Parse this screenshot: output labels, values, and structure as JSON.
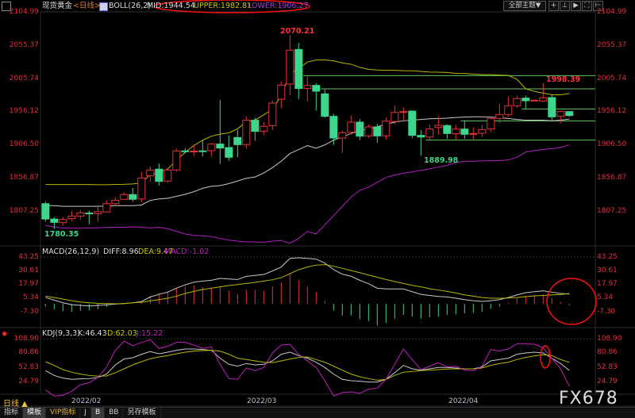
{
  "header": {
    "symbol": "现货黄金",
    "period": "<日线>",
    "indicator": "BOLL(26,2)",
    "mid": "MID:1944.54",
    "upper": "UPPER:1982.81",
    "lower": "LOWER:1906.27",
    "theme_button": "全部主题▼"
  },
  "macd_header": {
    "name": "MACD(26,12,9)",
    "diff": "DIFF:8.96",
    "dea": "DEA:9.47",
    "macd": "MACD:-1.02"
  },
  "kdj_header": {
    "name": "KDJ(9,3,3)",
    "k": "K:46.43",
    "d": "D:62.03",
    "j": "J:15.22"
  },
  "colors": {
    "up": "#e8303c",
    "down": "#3dd68c",
    "mid": "#c8c8c8",
    "upper": "#b8b800",
    "lower": "#b020c0",
    "axis": "#e03040",
    "annotation": "#ff1010"
  },
  "axes": {
    "price_ticks": [
      "2104.99",
      "2055.37",
      "2005.74",
      "1956.12",
      "1906.50",
      "1856.87",
      "1807.25"
    ],
    "macd_ticks": [
      "43.25",
      "30.61",
      "17.97",
      "5.34",
      "-7.30"
    ],
    "kdj_ticks": [
      "108.90",
      "80.86",
      "52.83",
      "24.79"
    ],
    "dates": [
      "2022/02",
      "2022/03",
      "2022/04"
    ]
  },
  "price_labels": {
    "high": "2070.21",
    "low": "1780.35",
    "recent_high": "1998.39",
    "recent_low": "1889.98"
  },
  "footer": {
    "period_label": "日线 ▲",
    "tabs": [
      "指标",
      "模板",
      "VIP指标",
      "J",
      "B",
      "BB",
      "另存模板"
    ],
    "watermark": "FX678"
  },
  "chart_data": {
    "type": "candlestick",
    "ohlc": [
      [
        1818,
        1821,
        1791,
        1795
      ],
      [
        1795,
        1798,
        1780.35,
        1790
      ],
      [
        1789.6,
        1798,
        1785,
        1794.4
      ],
      [
        1795.6,
        1807,
        1792,
        1799.5
      ],
      [
        1799.5,
        1809,
        1794,
        1804.3
      ],
      [
        1804,
        1808,
        1787,
        1803
      ],
      [
        1803,
        1813,
        1791,
        1806
      ],
      [
        1805.5,
        1823,
        1805,
        1818
      ],
      [
        1818,
        1828,
        1814,
        1823
      ],
      [
        1824.5,
        1835,
        1824,
        1831.6
      ],
      [
        1831.6,
        1841.5,
        1821,
        1824.5
      ],
      [
        1825,
        1865.6,
        1820,
        1856.5
      ],
      [
        1859.7,
        1873.5,
        1850.6,
        1868.4
      ],
      [
        1869.6,
        1878,
        1845,
        1851.4
      ],
      [
        1851.8,
        1871.5,
        1849.4,
        1868.4
      ],
      [
        1868.4,
        1900.4,
        1865.6,
        1896.9
      ],
      [
        1896.9,
        1901,
        1893,
        1896.1
      ],
      [
        1896.5,
        1907,
        1889,
        1896.7
      ],
      [
        1897,
        1913,
        1888.6,
        1896.5
      ],
      [
        1897.3,
        1909,
        1888.6,
        1907.2
      ],
      [
        1907.2,
        1973.2,
        1877.5,
        1901.2
      ],
      [
        1902,
        1920.2,
        1882.2,
        1887.4
      ],
      [
        1917,
        1928.9,
        1887.4,
        1906.4
      ],
      [
        1906.4,
        1948.7,
        1900.4,
        1942.8
      ],
      [
        1942.8,
        1946.7,
        1912.3,
        1926.2
      ],
      [
        1926.5,
        1940,
        1920.2,
        1933.7
      ],
      [
        1934.9,
        1972.4,
        1928.1,
        1968.5
      ],
      [
        1974.4,
        2001,
        1960.6,
        1995.4
      ],
      [
        1997,
        2070.21,
        1980.4,
        2047.6
      ],
      [
        2048.8,
        2058.7,
        1974.4,
        1990.3
      ],
      [
        1990.3,
        2008,
        1970.5,
        1995
      ],
      [
        1995,
        1998.2,
        1957.4,
        1986.3
      ],
      [
        1982.3,
        1989,
        1946.7,
        1948.7
      ],
      [
        1948.7,
        1952.7,
        1906,
        1916.3
      ],
      [
        1916.3,
        1927,
        1894,
        1924.2
      ],
      [
        1924.9,
        1949.5,
        1921.8,
        1940
      ],
      [
        1940,
        1944.7,
        1913,
        1919
      ],
      [
        1919.4,
        1936.8,
        1916.3,
        1932.9
      ],
      [
        1932.9,
        1937.6,
        1909,
        1919.4
      ],
      [
        1919.4,
        1946.7,
        1914,
        1941.6
      ],
      [
        1941,
        1964.5,
        1936.8,
        1954.6
      ],
      [
        1954.6,
        1962.2,
        1941.6,
        1955.8
      ],
      [
        1956.6,
        1957.4,
        1916.3,
        1920.2
      ],
      [
        1920.2,
        1928,
        1889.98,
        1917.8
      ],
      [
        1917.8,
        1936.8,
        1913.1,
        1929.7
      ],
      [
        1932,
        1948.7,
        1921,
        1935.2
      ],
      [
        1934.9,
        1936.8,
        1915,
        1923
      ],
      [
        1922.6,
        1936,
        1914,
        1929.7
      ],
      [
        1929.7,
        1942.8,
        1915,
        1921.8
      ],
      [
        1921.8,
        1931.7,
        1914.3,
        1923
      ],
      [
        1923.4,
        1936,
        1917.8,
        1928.9
      ],
      [
        1929.7,
        1946.7,
        1925,
        1945.5
      ],
      [
        1945.5,
        1967.7,
        1938.8,
        1951.5
      ],
      [
        1951.5,
        1978.4,
        1947.9,
        1964.5
      ],
      [
        1964.5,
        1979.6,
        1961.4,
        1975.2
      ],
      [
        1976,
        1979.6,
        1959.8,
        1972
      ],
      [
        1972,
        1973,
        1971.5,
        1972.8
      ],
      [
        1971.6,
        1998.39,
        1970,
        1976.4
      ],
      [
        1976.8,
        1981.2,
        1941.6,
        1947.9
      ],
      [
        1948.7,
        1957.4,
        1938.4,
        1955.8
      ],
      [
        1955.8,
        1956.6,
        1948,
        1949.9
      ]
    ],
    "boll_upper": [
      1846.6,
      1846.6,
      1846.6,
      1846.6,
      1846.6,
      1846.6,
      1846.4,
      1846.4,
      1846.8,
      1847,
      1847.5,
      1849,
      1861.7,
      1863.6,
      1870,
      1883,
      1895,
      1905,
      1913,
      1919,
      1922,
      1924,
      1930,
      1941,
      1943,
      1951,
      1959,
      1980,
      2012,
      2020,
      2030,
      2033,
      2033,
      2031.8,
      2028.6,
      2026.7,
      2022,
      2019,
      2018,
      2017.6,
      2017.6,
      2017,
      2016.8,
      2016,
      2015,
      2014.8,
      2014.4,
      2013,
      2012.8,
      2012,
      2011,
      2011,
      2010.4,
      2010,
      2004,
      1990,
      1986,
      1983.5,
      1981,
      1981,
      1982.81
    ],
    "boll_mid": [
      1815,
      1815,
      1814,
      1814,
      1814,
      1814,
      1814,
      1814.5,
      1815,
      1815,
      1815,
      1816,
      1823,
      1825,
      1826,
      1829,
      1832,
      1836,
      1841,
      1844,
      1845,
      1848,
      1852,
      1856,
      1858,
      1864,
      1872,
      1881.5,
      1893,
      1899,
      1905,
      1901,
      1906,
      1913,
      1918,
      1923,
      1927,
      1930,
      1933,
      1937,
      1940,
      1942,
      1943,
      1944,
      1945,
      1945.5,
      1946,
      1947,
      1947.5,
      1948,
      1948,
      1947.5,
      1946.7,
      1945.5,
      1944,
      1943,
      1943,
      1943,
      1942,
      1943,
      1944.54
    ],
    "boll_lower": [
      1785.3,
      1783.3,
      1781.7,
      1781.3,
      1781.3,
      1781.7,
      1781.7,
      1782.5,
      1782.5,
      1782.5,
      1783.3,
      1782.5,
      1781.7,
      1782.5,
      1780.5,
      1776.6,
      1772.6,
      1770.6,
      1769.9,
      1768.7,
      1766,
      1763.5,
      1762,
      1760.7,
      1760.7,
      1760.3,
      1762,
      1762.7,
      1758.8,
      1766,
      1776.6,
      1772.6,
      1786.5,
      1800,
      1814,
      1828,
      1838,
      1842.6,
      1849.8,
      1857,
      1860.9,
      1863.6,
      1865.6,
      1867.6,
      1870.3,
      1872.7,
      1875.5,
      1879.5,
      1881.4,
      1881.4,
      1882.2,
      1882.2,
      1882.6,
      1883.4,
      1887.4,
      1895.3,
      1897.3,
      1899.2,
      1900.4,
      1902,
      1906.27
    ],
    "drawn_lines": [
      {
        "price": 2009.6,
        "start": 30
      },
      {
        "price": 1989.9,
        "start": 32
      },
      {
        "price": 1959.8,
        "start": 55
      },
      {
        "price": 1942.0,
        "start": 48
      },
      {
        "price": 1913.1,
        "start": 44
      }
    ],
    "macd": {
      "diff": [
        5.8,
        3.4,
        1.0,
        -0.7,
        -1.4,
        -1.9,
        -1.4,
        -0.9,
        -0.2,
        0.3,
        1.0,
        2.2,
        6.3,
        8.7,
        10.7,
        14.3,
        17.4,
        19.8,
        20.8,
        21.5,
        23.2,
        22.7,
        22.2,
        25.1,
        25.9,
        26.8,
        30,
        33.6,
        41.5,
        42,
        41.5,
        40.8,
        37.2,
        31.2,
        27.1,
        25.1,
        21.5,
        18.4,
        14.3,
        13.6,
        13.6,
        13.6,
        11.1,
        8.7,
        7.7,
        6.8,
        6.3,
        5.1,
        3.9,
        2.9,
        2.2,
        2.9,
        3.9,
        5.8,
        8.2,
        10.2,
        11.1,
        11.9,
        10.7,
        9.5,
        8.96
      ],
      "dea": [
        7.0,
        5.8,
        4.4,
        2.9,
        1.7,
        1.0,
        0.5,
        0.3,
        0,
        0.3,
        1.0,
        1.5,
        2.7,
        3.9,
        5.1,
        7.0,
        9.5,
        11.4,
        13.1,
        14.3,
        15.5,
        16.7,
        17.6,
        18.6,
        19.6,
        20.8,
        22,
        23.9,
        27.5,
        31.2,
        33.6,
        35.3,
        35.8,
        34.3,
        32.4,
        30.4,
        28.5,
        26.3,
        24.2,
        22.2,
        20.3,
        18.6,
        16.9,
        15.5,
        13.8,
        12.6,
        11.4,
        9.9,
        8.2,
        7.0,
        5.8,
        5.1,
        5.1,
        5.3,
        5.8,
        6.6,
        7.3,
        7.7,
        8.2,
        8.5,
        9.47
      ],
      "hist": [
        -2.4,
        -4.8,
        -6.8,
        -7.2,
        -6.2,
        -5.8,
        -4.8,
        -2.8,
        -0.4,
        -0.4,
        0,
        1.4,
        7.2,
        9.6,
        11.2,
        14.6,
        15.8,
        16.8,
        15.4,
        14.4,
        15.4,
        12,
        9.2,
        13,
        12.6,
        12,
        16,
        19.4,
        28,
        21.6,
        15.8,
        11,
        2.8,
        -6.2,
        -10.6,
        -10.6,
        -14,
        -15.8,
        -19.8,
        -17.2,
        -13.4,
        -10,
        -11.6,
        -13.6,
        -12.2,
        -11.6,
        -10.2,
        -9.6,
        -8.6,
        -8.2,
        -7.2,
        -4.4,
        -2.4,
        1,
        4.8,
        7.2,
        7.6,
        8.4,
        5,
        2,
        -1.02
      ],
      "ylim": [
        -14,
        45
      ]
    },
    "kdj": {
      "k": [
        46,
        36.7,
        31.5,
        29,
        30,
        30.5,
        32.6,
        39.3,
        57.3,
        68.7,
        71.3,
        78,
        83.2,
        79,
        82.1,
        85.7,
        88.3,
        88.3,
        87.3,
        85.7,
        70.3,
        58.4,
        54.8,
        59.9,
        57.3,
        58.4,
        65.1,
        78,
        82.1,
        75.4,
        70.3,
        62.5,
        52.2,
        39.3,
        29,
        26.4,
        25.3,
        23.8,
        23.8,
        29,
        41.9,
        56.3,
        49.6,
        47,
        49.6,
        52.2,
        52.2,
        51.2,
        49.6,
        49.6,
        53.2,
        65.1,
        67.7,
        70.3,
        78,
        80.6,
        82.1,
        80.6,
        70.3,
        59.9,
        46.43
      ],
      "d": [
        63.5,
        56.3,
        48,
        42.9,
        39.3,
        36.7,
        35.2,
        35.7,
        41.9,
        49.6,
        57.3,
        63.5,
        69.2,
        72.8,
        75.4,
        79,
        82.1,
        84.2,
        85.2,
        85.7,
        84.2,
        78,
        70.3,
        67.7,
        65.1,
        62.5,
        61.5,
        65.1,
        68.7,
        71.8,
        72.8,
        67.7,
        62.5,
        54.8,
        47,
        39.3,
        34.1,
        30.5,
        27.4,
        29,
        36.7,
        42.9,
        44.4,
        46,
        47,
        48,
        49.1,
        49.6,
        49.6,
        49.6,
        51.2,
        56.3,
        59.9,
        62.5,
        67.7,
        71.8,
        74.9,
        77,
        75.4,
        67.7,
        62.03
      ],
      "j": [
        8.3,
        -3.6,
        -2,
        5.7,
        18.6,
        22.2,
        32.6,
        53.2,
        85.7,
        103.8,
        94.5,
        101.2,
        106.4,
        89.4,
        93.5,
        101.2,
        101.2,
        96.1,
        89.4,
        92.5,
        58.4,
        30.5,
        29,
        51.2,
        46,
        52.2,
        80.6,
        96.1,
        97.6,
        78,
        65.1,
        52.2,
        26.4,
        -3.6,
        3.1,
        4.7,
        1.6,
        9.8,
        11.9,
        29,
        58.4,
        88.3,
        67.7,
        48,
        54.8,
        61.5,
        53.2,
        54.8,
        47,
        46,
        54.8,
        87.3,
        84.2,
        88.3,
        98.6,
        98.6,
        97.6,
        90.9,
        70.3,
        49.6,
        15.22
      ],
      "ylim": [
        -5,
        116
      ]
    }
  }
}
